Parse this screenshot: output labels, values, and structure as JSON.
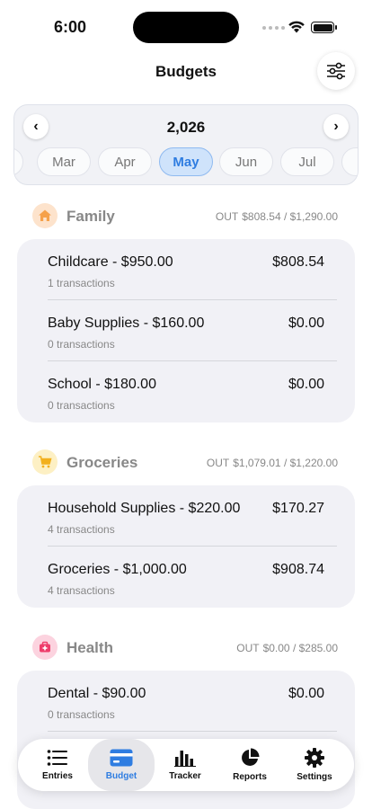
{
  "status": {
    "time": "6:00"
  },
  "header": {
    "title": "Budgets"
  },
  "month_selector": {
    "year": "2,026",
    "months": [
      "Mar",
      "Apr",
      "May",
      "Jun",
      "Jul"
    ],
    "selected": "May"
  },
  "categories": [
    {
      "name": "Family",
      "out_label": "OUT",
      "out_value": "$808.54 / $1,290.00",
      "icon": "house-icon",
      "color": "#f5a14a",
      "items": [
        {
          "title": "Childcare - $950.00",
          "sub": "1 transactions",
          "amount": "$808.54"
        },
        {
          "title": "Baby Supplies - $160.00",
          "sub": "0 transactions",
          "amount": "$0.00"
        },
        {
          "title": "School - $180.00",
          "sub": "0 transactions",
          "amount": "$0.00"
        }
      ]
    },
    {
      "name": "Groceries",
      "out_label": "OUT",
      "out_value": "$1,079.01 / $1,220.00",
      "icon": "cart-icon",
      "color": "#f2b01e",
      "items": [
        {
          "title": "Household Supplies - $220.00",
          "sub": "4 transactions",
          "amount": "$170.27"
        },
        {
          "title": "Groceries - $1,000.00",
          "sub": "4 transactions",
          "amount": "$908.74"
        }
      ]
    },
    {
      "name": "Health",
      "out_label": "OUT",
      "out_value": "$0.00 / $285.00",
      "icon": "medical-kit-icon",
      "color": "#ee3d6b",
      "items": [
        {
          "title": "Dental - $90.00",
          "sub": "0 transactions",
          "amount": "$0.00"
        }
      ]
    }
  ],
  "tabs": [
    {
      "label": "Entries",
      "icon": "list-icon"
    },
    {
      "label": "Budget",
      "icon": "card-icon",
      "active": true
    },
    {
      "label": "Tracker",
      "icon": "bar-chart-icon"
    },
    {
      "label": "Reports",
      "icon": "pie-chart-icon"
    },
    {
      "label": "Settings",
      "icon": "gear-icon"
    }
  ]
}
